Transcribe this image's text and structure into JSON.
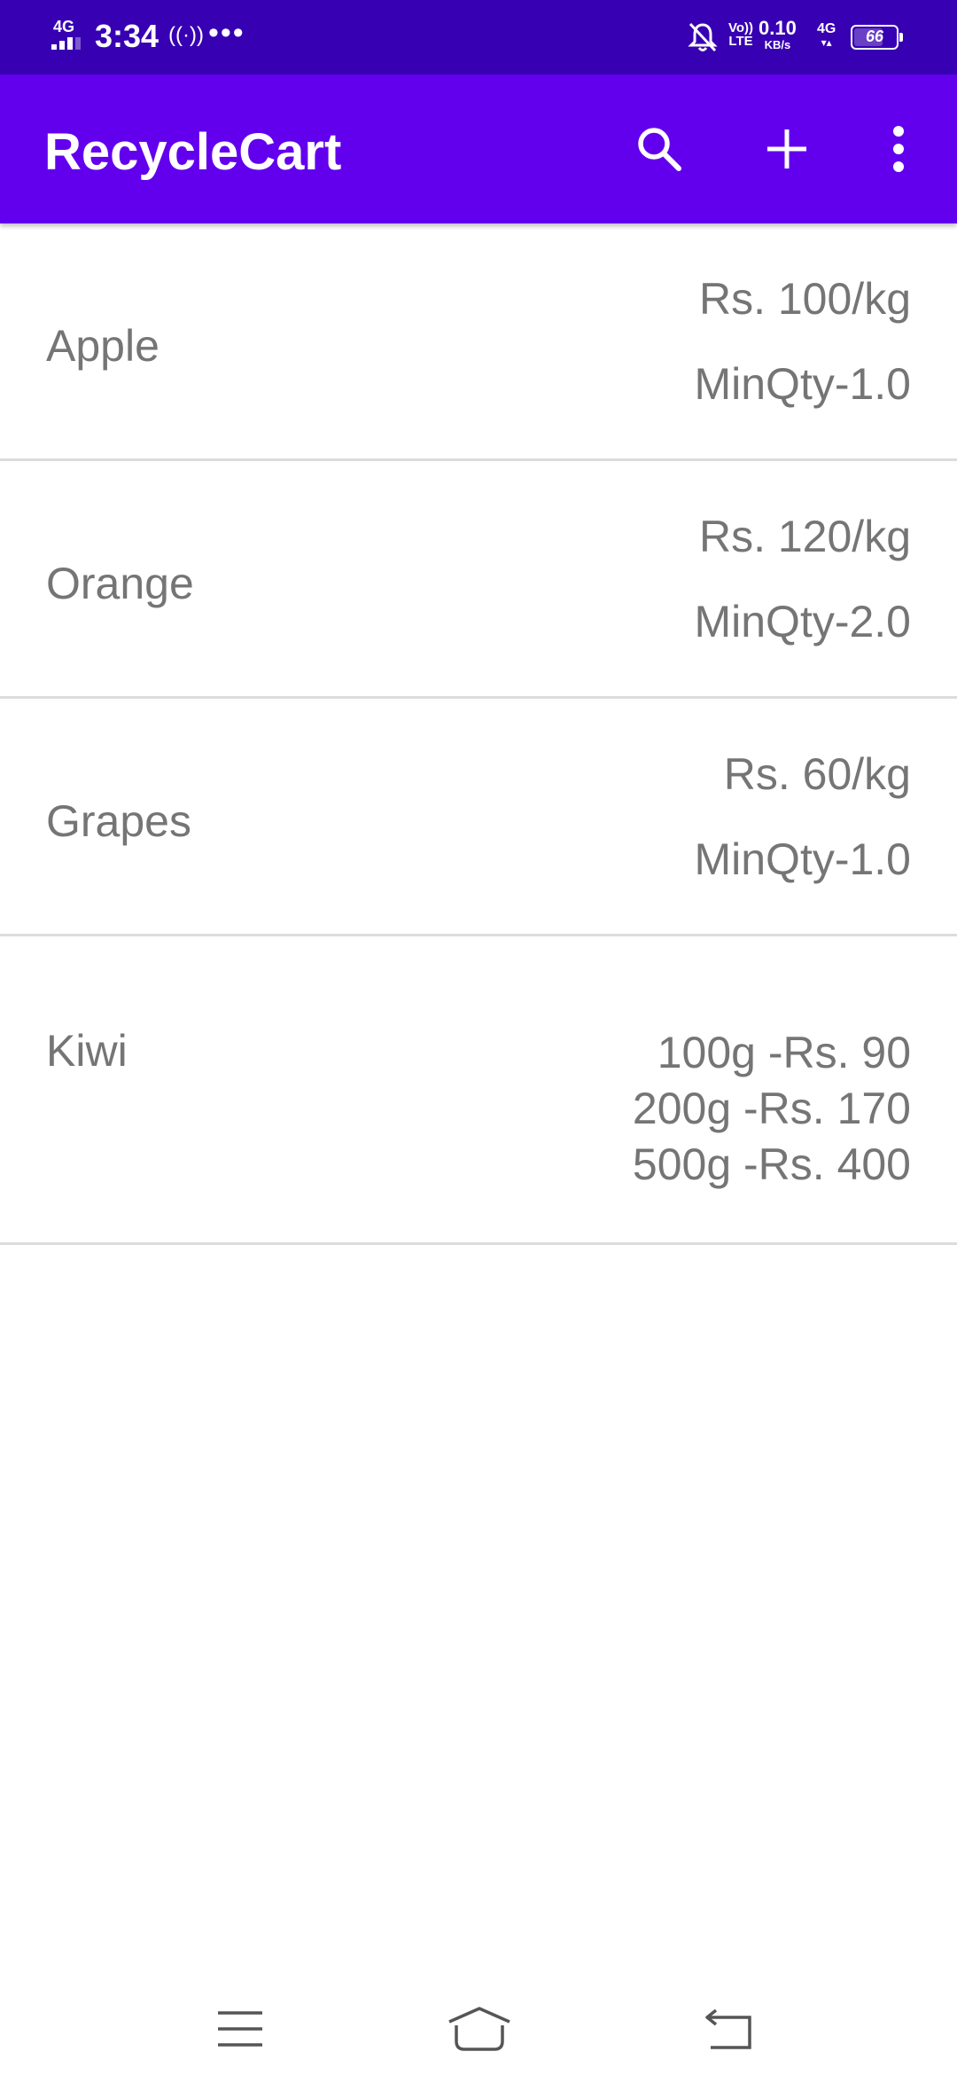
{
  "status_bar": {
    "network": "4G",
    "time": "3:34",
    "hotspot_icon": "((·))",
    "more_dots": "•••",
    "volte_top": "Vo))",
    "volte_bottom": "LTE",
    "speed_value": "0.10",
    "speed_unit": "KB/s",
    "network2": "4G",
    "network2_arrows": "▾▴",
    "battery": "66"
  },
  "app_bar": {
    "title": "RecycleCart",
    "icons": [
      "search-icon",
      "add-icon",
      "more-vert-icon"
    ]
  },
  "products": [
    {
      "name": "Apple",
      "price": "Rs. 100/kg",
      "min_qty": "MinQty-1.0"
    },
    {
      "name": "Orange",
      "price": "Rs. 120/kg",
      "min_qty": "MinQty-2.0"
    },
    {
      "name": "Grapes",
      "price": "Rs. 60/kg",
      "min_qty": "MinQty-1.0"
    },
    {
      "name": "Kiwi",
      "options": [
        "100g -Rs. 90",
        "200g -Rs. 170",
        "500g -Rs. 400"
      ]
    }
  ],
  "nav_bar": {
    "icons": [
      "menu-icon",
      "home-icon",
      "back-icon"
    ]
  },
  "colors": {
    "status_bar": "#3700B3",
    "app_bar": "#6200EE",
    "text_secondary": "#757575",
    "divider": "#dcdcdc"
  }
}
